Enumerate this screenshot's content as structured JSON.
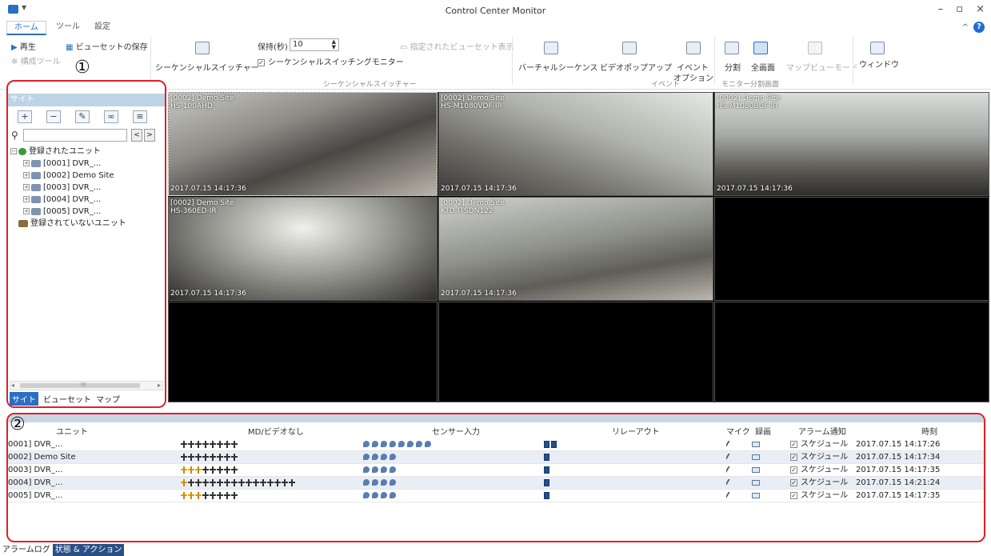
{
  "window": {
    "title": "Control Center Monitor",
    "minimize": "–",
    "restore": "▫",
    "close": "×"
  },
  "menu_tabs": [
    "ホーム",
    "ツール",
    "設定"
  ],
  "help": {
    "caret": "^",
    "icon": "?"
  },
  "ribbon": {
    "play": "再生",
    "save_viewset": "ビューセットの保存",
    "config_tool": "構成ツール",
    "seq_switcher": "シーケンシャルスイッチャー",
    "hold_label": "保持(秒)",
    "hold_value": "10",
    "seq_monitor": "シーケンシャルスイッチングモニター",
    "specified_viewset": "指定されたビューセット表示",
    "seq_group": "シーケンシャルスイッチャー",
    "virtual_seq": "バーチャルシーケンス",
    "video_popup": "ビデオポップアップ",
    "event_option_1": "イベント",
    "event_option_2": "オプション",
    "event_group": "イベント",
    "split": "分割",
    "fullscreen": "全画面",
    "monitor_group": "モニター分割画面",
    "map_view": "マップビューモード",
    "window": "ウィンドウ"
  },
  "indicators": {
    "one": "①",
    "two": "②"
  },
  "site_panel": {
    "header": "サイト",
    "search_placeholder": "",
    "prev": "<",
    "next": ">",
    "tree": {
      "registered": "登録されたユニット",
      "units": [
        "[0001] DVR_...",
        "[0002] Demo Site",
        "[0003] DVR_...",
        "[0004] DVR_...",
        "[0005] DVR_..."
      ],
      "unregistered": "登録されていないユニット"
    },
    "scroll_mid": "III",
    "tabs": [
      "サイト",
      "ビューセット",
      "マップ"
    ]
  },
  "videos": [
    {
      "name": "[0002] Demo Site",
      "model": "HS-100AHD",
      "time": "2017.07.15 14:17:36"
    },
    {
      "name": "[0002] Demo Site",
      "model": "HS-M1080VDF-IR",
      "time": "2017.07.15 14:17:36"
    },
    {
      "name": "[0002] Demo Site",
      "model": "HS-M1080BUF-IR",
      "time": "2017.07.15 14:17:36"
    },
    {
      "name": "[0002] Demo Site",
      "model": "HS-360ED-IR",
      "time": "2017.07.15 14:17:36"
    },
    {
      "name": "[0002] Demo Site",
      "model": "KTD-ITSDN122",
      "time": "2017.07.15 14:17:36"
    }
  ],
  "status_table": {
    "headers": {
      "unit": "ユニット",
      "md": "MD/ビデオなし",
      "sensor": "センサー入力",
      "relay": "リレーアウト",
      "mic": "マイク",
      "rec": "録画",
      "alarm": "アラーム通知",
      "time": "時刻"
    },
    "rows": [
      {
        "unit": "0001] DVR_...",
        "md_on": 0,
        "md_count": 8,
        "sensors": 8,
        "relays": 2,
        "alarm": "スケジュール",
        "time": "2017.07.15 14:17:26"
      },
      {
        "unit": "0002] Demo Site",
        "md_on": 0,
        "md_count": 8,
        "sensors": 4,
        "relays": 1,
        "alarm": "スケジュール",
        "time": "2017.07.15 14:17:34"
      },
      {
        "unit": "0003] DVR_...",
        "md_on": 3,
        "md_count": 8,
        "sensors": 4,
        "relays": 1,
        "alarm": "スケジュール",
        "time": "2017.07.15 14:17:35"
      },
      {
        "unit": "0004] DVR_...",
        "md_on": 1,
        "md_count": 16,
        "sensors": 4,
        "relays": 1,
        "alarm": "スケジュール",
        "time": "2017.07.15 14:21:24"
      },
      {
        "unit": "0005] DVR_...",
        "md_on": 3,
        "md_count": 8,
        "sensors": 4,
        "relays": 1,
        "alarm": "スケジュール",
        "time": "2017.07.15 14:17:35"
      }
    ]
  },
  "bottom_tabs": [
    "アラームログ",
    "状態 & アクション"
  ]
}
